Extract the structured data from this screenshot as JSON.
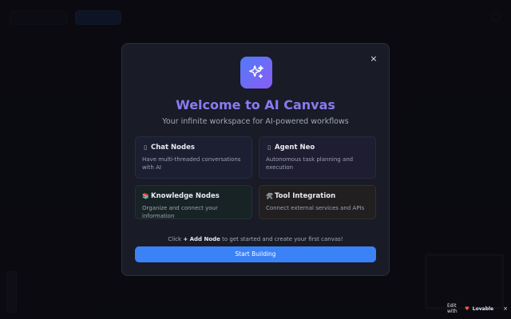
{
  "modal": {
    "close_glyph": "×",
    "title": "Welcome to AI Canvas",
    "subtitle": "Your infinite workspace for AI-powered workflows",
    "cards": [
      {
        "glyph": "▯",
        "title": "Chat Nodes",
        "desc": "Have multi-threaded conversations with AI"
      },
      {
        "glyph": "▯",
        "title": "Agent Neo",
        "desc": "Autonomous task planning and execution"
      },
      {
        "glyph": "📚",
        "title": "Knowledge Nodes",
        "desc": "Organize and connect your information"
      },
      {
        "glyph": "🛠",
        "title": "Tool Integration",
        "desc": "Connect external services and APIs"
      }
    ],
    "hint_prefix": "Click",
    "hint_bold": "+ Add Node",
    "hint_suffix": "to get started and create your first canvas!",
    "start_label": "Start Building"
  },
  "badge": {
    "edit_with": "Edit with",
    "brand": "Lovable",
    "heart": "♥",
    "close": "×"
  },
  "icons": {
    "logo": "sparkles-icon"
  },
  "colors": {
    "accent": "#3b82f6",
    "title_gradient_start": "#4f7bf6",
    "title_gradient_end": "#8b5cf6"
  }
}
